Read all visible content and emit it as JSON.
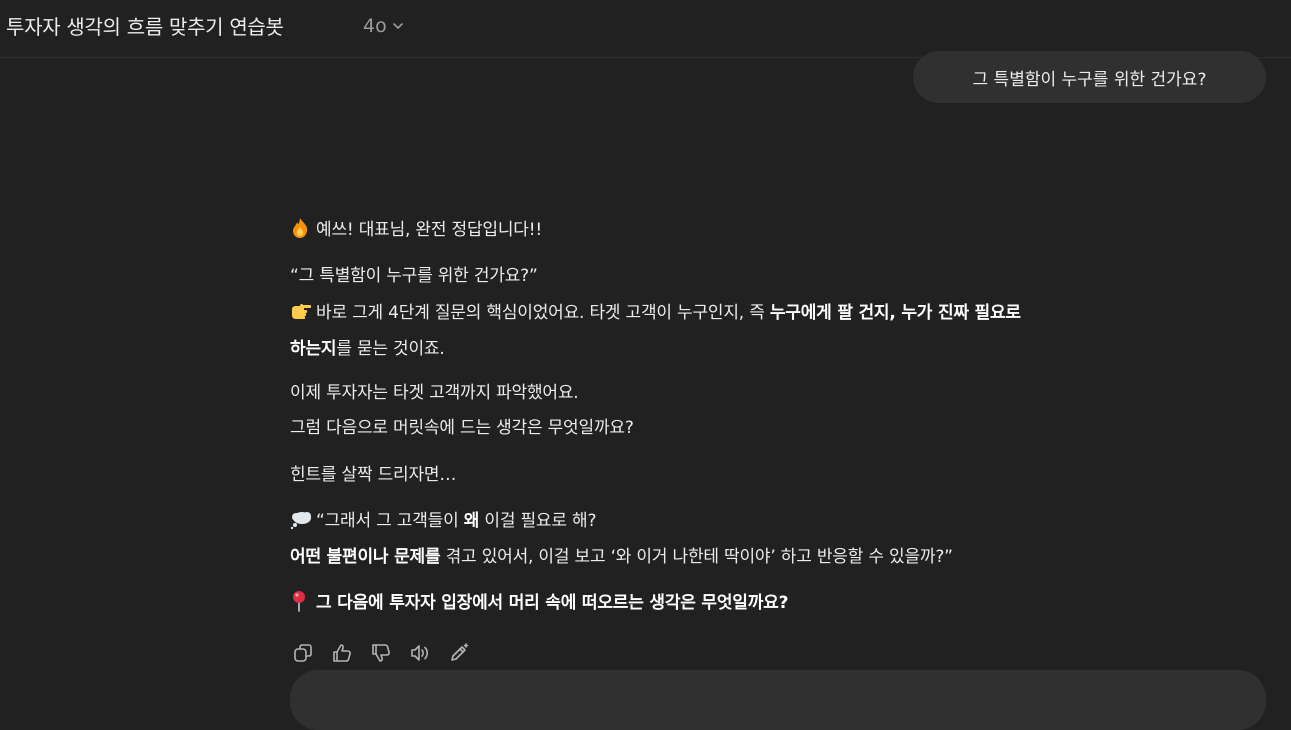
{
  "header": {
    "title": "투자자 생각의 흐름 맞추기 연습봇",
    "model": "4o"
  },
  "user_message": "그 특별함이 누구를 위한 건가요?",
  "assistant": {
    "line1": "예쓰! 대표님, 완전 정답입니다!!",
    "quote1": "“그 특별함이 누구를 위한 건가요?”",
    "p2_a": "바로 그게 4단계 질문의 핵심이었어요. 타겟 고객이 누구인지, 즉 ",
    "p2_bold1": "누구에게 팔 건지, 누가 진짜 필요로",
    "p2_bold2": "하는지",
    "p2_b": "를 묻는 것이죠.",
    "p3_line1": "이제 투자자는 타겟 고객까지 파악했어요.",
    "p3_line2": "그럼 다음으로 머릿속에 드는 생각은 무엇일까요?",
    "hint": "힌트를 살짝 드리자면…",
    "thought_a": "“그래서 그 고객들이 ",
    "thought_bold": "왜",
    "thought_b": " 이걸 필요로 해?",
    "thought2_bold": "어떤 불편이나 문제를",
    "thought2_rest": " 겪고 있어서, 이걸 보고 ‘와 이거 나한테 딱이야’ 하고 반응할 수 있을까?”",
    "question": "그 다음에 투자자 입장에서 머리 속에 떠오르는 생각은 무엇일까요?"
  },
  "icons": {
    "fire": "fire-emoji",
    "pointing": "backhand-index-pointing-right-emoji",
    "thought": "thought-balloon-emoji",
    "pin": "round-pushpin-emoji"
  },
  "colors": {
    "background": "#212121",
    "bubble": "#303030",
    "text": "#ececec",
    "muted": "#9b9b9b"
  }
}
